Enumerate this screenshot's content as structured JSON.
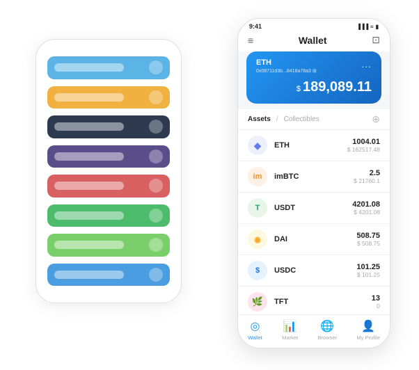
{
  "scene": {
    "bg_phone": {
      "cards": [
        {
          "color": "c1",
          "label": ""
        },
        {
          "color": "c2",
          "label": ""
        },
        {
          "color": "c3",
          "label": ""
        },
        {
          "color": "c4",
          "label": ""
        },
        {
          "color": "c5",
          "label": ""
        },
        {
          "color": "c6",
          "label": ""
        },
        {
          "color": "c7",
          "label": ""
        },
        {
          "color": "c8",
          "label": ""
        }
      ]
    },
    "fg_phone": {
      "status_bar": {
        "time": "9:41",
        "signal": "▐▐▐",
        "wifi": "WiFi",
        "battery": "■"
      },
      "header": {
        "menu_icon": "≡",
        "title": "Wallet",
        "expand_icon": "⊡"
      },
      "wallet_card": {
        "title": "ETH",
        "address": "0x08711d3b...8418a78a3",
        "address_suffix": "⊞",
        "dots": "...",
        "currency_symbol": "$",
        "amount": "189,089.11"
      },
      "assets_section": {
        "tab_active": "Assets",
        "separator": "/",
        "tab_inactive": "Collectibles",
        "add_icon": "⊕"
      },
      "assets": [
        {
          "name": "ETH",
          "icon": "◆",
          "icon_class": "eth-icon",
          "amount": "1004.01",
          "usd": "$ 162517.48"
        },
        {
          "name": "imBTC",
          "icon": "◎",
          "icon_class": "imbtc-icon",
          "amount": "2.5",
          "usd": "$ 21760.1"
        },
        {
          "name": "USDT",
          "icon": "T",
          "icon_class": "usdt-icon",
          "amount": "4201.08",
          "usd": "$ 4201.08"
        },
        {
          "name": "DAI",
          "icon": "◉",
          "icon_class": "dai-icon",
          "amount": "508.75",
          "usd": "$ 508.75"
        },
        {
          "name": "USDC",
          "icon": "$",
          "icon_class": "usdc-icon",
          "amount": "101.25",
          "usd": "$ 101.25"
        },
        {
          "name": "TFT",
          "icon": "🌿",
          "icon_class": "tft-icon",
          "amount": "13",
          "usd": "0"
        }
      ],
      "bottom_nav": [
        {
          "label": "Wallet",
          "icon": "◎",
          "active": true
        },
        {
          "label": "Market",
          "icon": "📈",
          "active": false
        },
        {
          "label": "Browser",
          "icon": "🌐",
          "active": false
        },
        {
          "label": "My Profile",
          "icon": "👤",
          "active": false
        }
      ]
    }
  }
}
